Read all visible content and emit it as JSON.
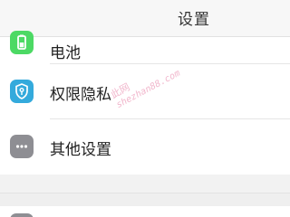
{
  "header": {
    "title": "设置"
  },
  "settings": {
    "items": [
      {
        "label": "电池",
        "icon": "battery-icon",
        "icon_color": "#4cd964"
      },
      {
        "label": "权限隐私",
        "icon": "privacy-shield-icon",
        "icon_color": "#34aadc"
      },
      {
        "label": "其他设置",
        "icon": "more-icon",
        "icon_color": "#8e8e93"
      }
    ]
  },
  "watermark": {
    "line1": "此网",
    "line2": "shezhan88.com"
  }
}
